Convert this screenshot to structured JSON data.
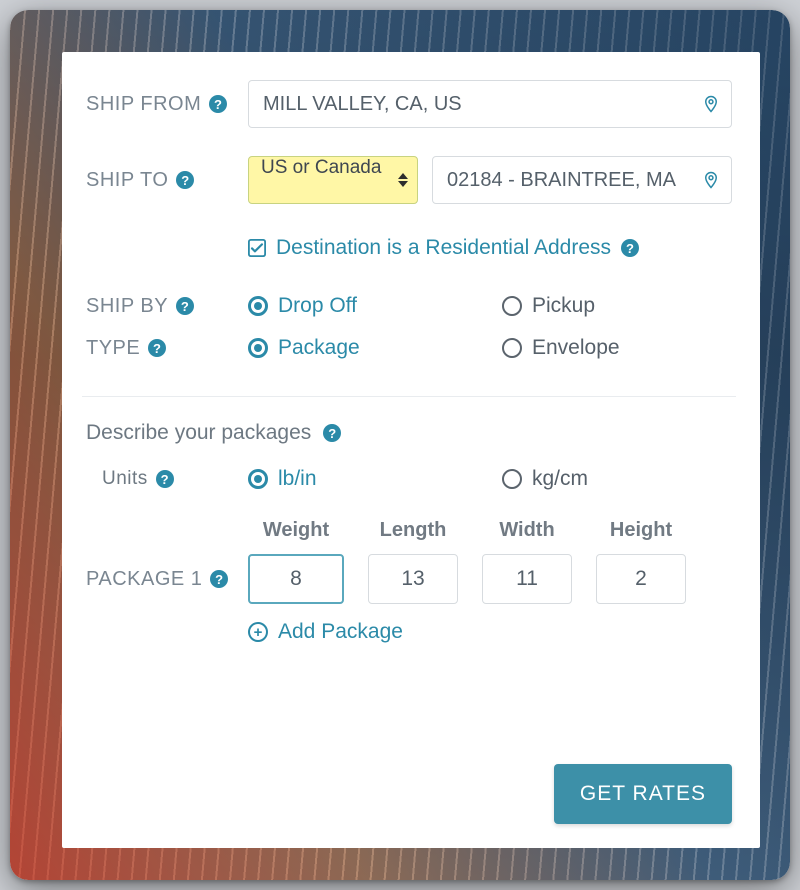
{
  "shipFrom": {
    "label": "SHIP FROM",
    "value": "MILL VALLEY, CA, US"
  },
  "shipTo": {
    "label": "SHIP TO",
    "regionSelect": "US or Canada",
    "value": "02184 - BRAINTREE, MA"
  },
  "residential": {
    "label": "Destination is a Residential Address",
    "checked": true
  },
  "shipBy": {
    "label": "SHIP BY",
    "options": [
      "Drop Off",
      "Pickup"
    ],
    "selected": "Drop Off"
  },
  "type": {
    "label": "TYPE",
    "options": [
      "Package",
      "Envelope"
    ],
    "selected": "Package"
  },
  "describe": {
    "title": "Describe your packages"
  },
  "units": {
    "label": "Units",
    "options": [
      "lb/in",
      "kg/cm"
    ],
    "selected": "lb/in"
  },
  "package": {
    "label": "PACKAGE 1",
    "headers": {
      "weight": "Weight",
      "length": "Length",
      "width": "Width",
      "height": "Height"
    },
    "weight": "8",
    "length": "13",
    "width": "11",
    "height": "2",
    "addLabel": "Add Package"
  },
  "button": {
    "getRates": "GET RATES"
  }
}
